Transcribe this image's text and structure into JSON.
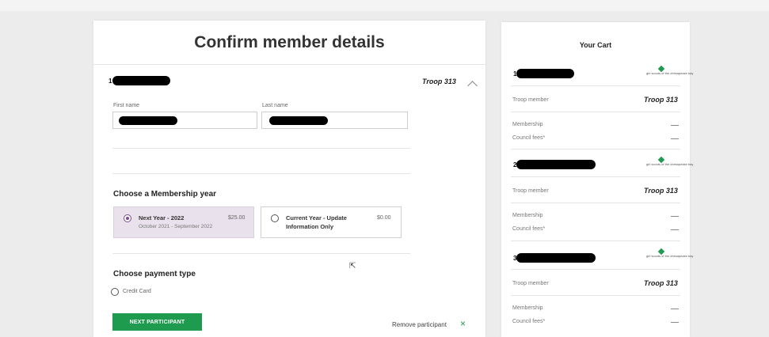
{
  "main": {
    "title": "Confirm member details",
    "participant": {
      "number": "1",
      "troop": "Troop 313",
      "first_name_label": "First name",
      "last_name_label": "Last name"
    },
    "membership": {
      "heading": "Choose a Membership year",
      "options": [
        {
          "title": "Next Year - 2022",
          "price": "$25.00",
          "subtitle": "October 2021 - September 2022",
          "selected": true
        },
        {
          "title": "Current Year - Update",
          "title2": "Information Only",
          "price": "$0.00",
          "selected": false
        }
      ]
    },
    "payment": {
      "heading": "Choose payment type",
      "options": [
        {
          "label": "Credit Card",
          "selected": false
        }
      ]
    },
    "next_button": "NEXT PARTICIPANT",
    "remove_label": "Remove participant",
    "remove_icon": "×"
  },
  "cart": {
    "title": "Your Cart",
    "logo_text": "girl scouts of the chesapeake bay",
    "items": [
      {
        "number": "1",
        "troop_label": "Troop member",
        "troop": "Troop 313",
        "membership_label": "Membership",
        "fees_label": "Council fees*"
      },
      {
        "number": "2",
        "troop_label": "Troop member",
        "troop": "Troop 313",
        "membership_label": "Membership",
        "fees_label": "Council fees*"
      },
      {
        "number": "3",
        "troop_label": "Troop member",
        "troop": "Troop 313",
        "membership_label": "Membership",
        "fees_label": "Council fees*"
      }
    ]
  },
  "colors": {
    "accent": "#1e9b4e",
    "selected_bg": "#e9e1ec",
    "radio": "#7a4a8c"
  }
}
